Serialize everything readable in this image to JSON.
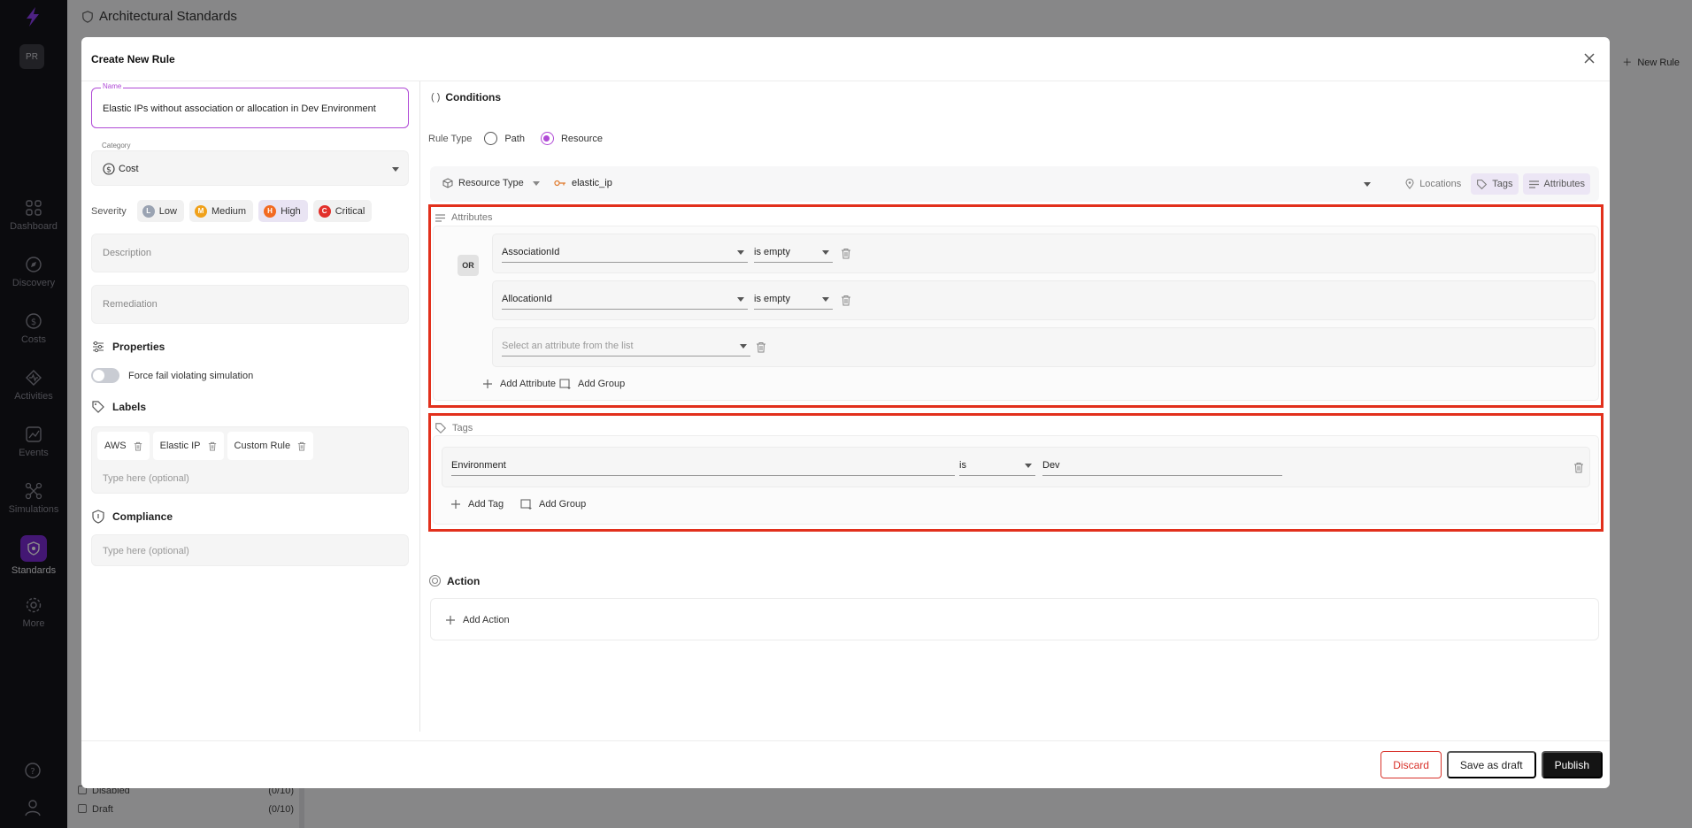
{
  "app": {
    "page_title": "Architectural Standards",
    "avatar_initials": "PR",
    "new_rule_label": "New Rule",
    "nav": [
      {
        "label": "Dashboard",
        "icon": "dashboard-icon"
      },
      {
        "label": "Discovery",
        "icon": "compass-icon"
      },
      {
        "label": "Costs",
        "icon": "dollar-icon"
      },
      {
        "label": "Activities",
        "icon": "activity-icon"
      },
      {
        "label": "Events",
        "icon": "chart-icon"
      },
      {
        "label": "Simulations",
        "icon": "network-icon"
      },
      {
        "label": "Standards",
        "icon": "shield-icon"
      },
      {
        "label": "More",
        "icon": "gear-icon"
      }
    ],
    "bg_filters": [
      {
        "label": "Disabled",
        "count": "(0/10)"
      },
      {
        "label": "Draft",
        "count": "(0/10)"
      }
    ]
  },
  "modal": {
    "title": "Create New Rule",
    "name": {
      "label": "Name",
      "value": "Elastic IPs without association or allocation in Dev Environment"
    },
    "category": {
      "label": "Category",
      "value": "Cost"
    },
    "severity": {
      "label": "Severity",
      "options": [
        {
          "letter": "L",
          "label": "Low",
          "color": "#9aa3b2"
        },
        {
          "letter": "M",
          "label": "Medium",
          "color": "#f0a11a"
        },
        {
          "letter": "H",
          "label": "High",
          "color": "#f26a21"
        },
        {
          "letter": "C",
          "label": "Critical",
          "color": "#e2302a"
        }
      ],
      "selected": "High"
    },
    "description_placeholder": "Description",
    "remediation_placeholder": "Remediation",
    "properties_title": "Properties",
    "force_fail_label": "Force fail violating simulation",
    "labels_title": "Labels",
    "labels": [
      "AWS",
      "Elastic IP",
      "Custom Rule"
    ],
    "labels_placeholder": "Type here (optional)",
    "compliance_title": "Compliance",
    "compliance_placeholder": "Type here (optional)",
    "conditions": {
      "title": "Conditions",
      "rule_type_label": "Rule Type",
      "rule_type_options": [
        "Path",
        "Resource"
      ],
      "rule_type_selected": "Resource",
      "resource_type_label": "Resource Type",
      "resource_type_value": "elastic_ip",
      "toolbar_buttons": [
        "Locations",
        "Tags",
        "Attributes"
      ],
      "attributes": {
        "title": "Attributes",
        "operator": "OR",
        "rows": [
          {
            "attribute": "AssociationId",
            "op": "is empty"
          },
          {
            "attribute": "AllocationId",
            "op": "is empty"
          }
        ],
        "empty_placeholder": "Select an attribute from the list",
        "add_attribute": "Add Attribute",
        "add_group": "Add Group"
      },
      "tags": {
        "title": "Tags",
        "rows": [
          {
            "key": "Environment",
            "op": "is",
            "value": "Dev"
          }
        ],
        "add_tag": "Add Tag",
        "add_group": "Add Group"
      }
    },
    "action": {
      "title": "Action",
      "add_action": "Add Action"
    },
    "footer": {
      "discard": "Discard",
      "save_draft": "Save as draft",
      "publish": "Publish"
    }
  }
}
